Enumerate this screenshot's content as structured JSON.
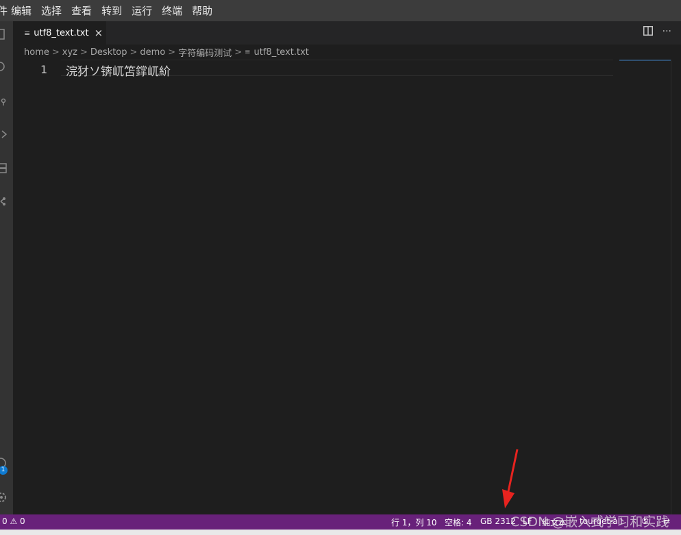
{
  "menubar": {
    "items": [
      "件",
      "编辑",
      "选择",
      "查看",
      "转到",
      "运行",
      "终端",
      "帮助"
    ]
  },
  "activity_bar": {
    "icons": [
      "explorer-icon",
      "search-icon",
      "source-control-icon",
      "run-debug-icon",
      "extensions-icon",
      "remote-icon",
      "account-icon",
      "settings-gear-icon"
    ],
    "account_badge": "1"
  },
  "tab": {
    "label": "utf8_text.txt",
    "icon": "≡",
    "close": "×"
  },
  "tab_actions": {
    "more": "···"
  },
  "breadcrumb": {
    "parts": [
      "home",
      "xyz",
      "Desktop",
      "demo",
      "字符编码测试",
      "utf8_text.txt"
    ],
    "separator": ">"
  },
  "editor": {
    "line_number": "1",
    "line_text": "浣犲ソ锛屼笘鐣屼紒"
  },
  "statusbar": {
    "problems": "0 ⚠ 0",
    "cursor": "行 1，列 10",
    "spaces": "空格: 4",
    "encoding": "GB 2312",
    "eol": "LF",
    "language": "纯文本",
    "extension": "tourget-all",
    "extra": "⑤",
    "remote_icon": "⇄"
  },
  "watermark": "CSDN @嵌入式学习和实践",
  "colors": {
    "statusbar": "#68217a",
    "editor_bg": "#1e1e1e",
    "menubar": "#3c3c3c",
    "arrow": "#e8231f",
    "badge": "#0e7ad1"
  }
}
